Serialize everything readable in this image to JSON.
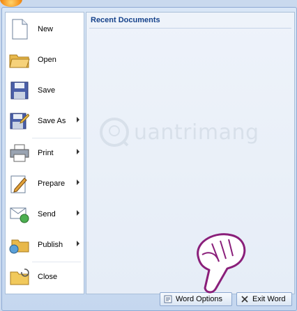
{
  "menu": {
    "items": [
      {
        "label": "New",
        "arrow": false,
        "icon": "new-document-icon"
      },
      {
        "label": "Open",
        "arrow": false,
        "icon": "open-folder-icon"
      },
      {
        "label": "Save",
        "arrow": false,
        "icon": "save-disk-icon"
      },
      {
        "label": "Save As",
        "arrow": true,
        "icon": "save-as-icon"
      },
      {
        "label": "Print",
        "arrow": true,
        "icon": "printer-icon"
      },
      {
        "label": "Prepare",
        "arrow": true,
        "icon": "prepare-pen-icon"
      },
      {
        "label": "Send",
        "arrow": true,
        "icon": "send-mail-icon"
      },
      {
        "label": "Publish",
        "arrow": true,
        "icon": "publish-folder-icon"
      },
      {
        "label": "Close",
        "arrow": false,
        "icon": "close-folder-icon"
      }
    ]
  },
  "recent": {
    "title": "Recent Documents"
  },
  "watermark": {
    "text": "uantrimang"
  },
  "footer": {
    "options_label": "Word Options",
    "exit_label": "Exit Word"
  },
  "colors": {
    "accent": "#15428b",
    "orb": "#f7941d"
  }
}
